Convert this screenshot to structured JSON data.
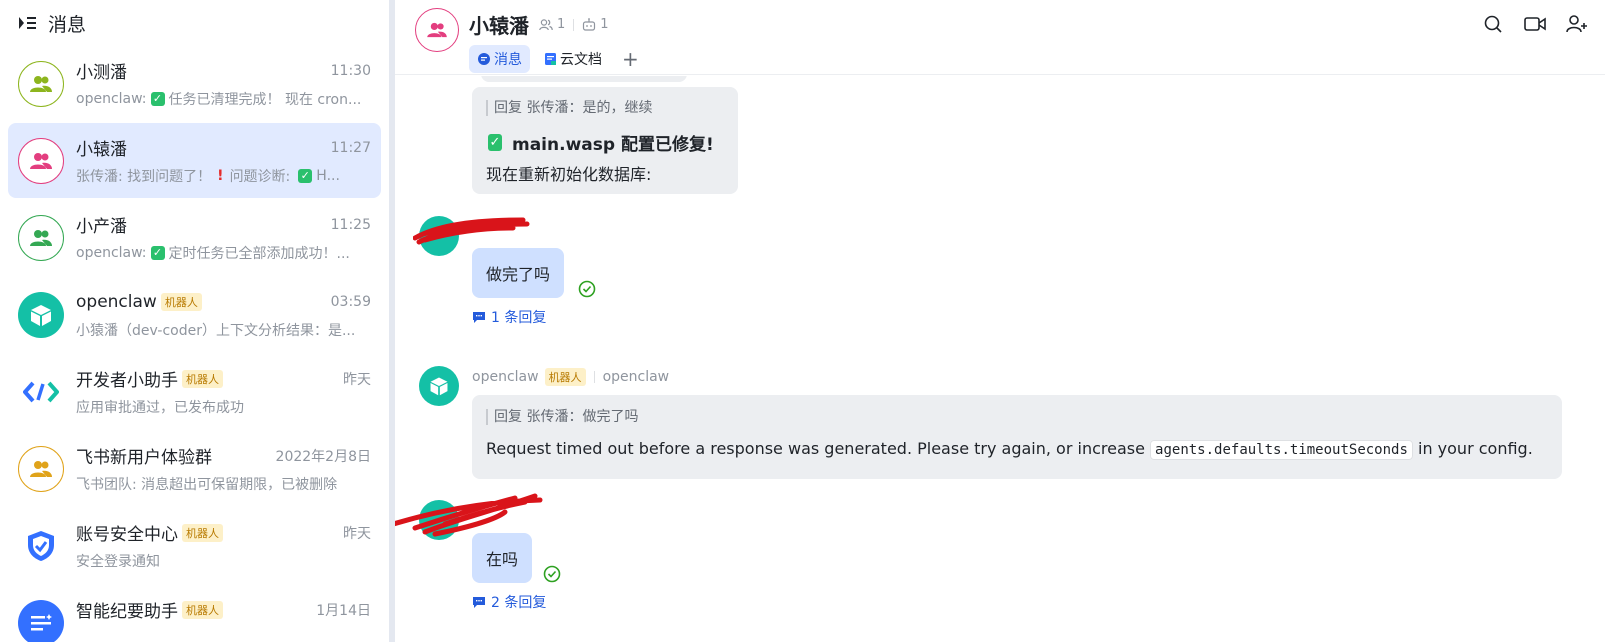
{
  "sidebar": {
    "title": "消息",
    "chats": [
      {
        "name": "小测潘",
        "time": "11:30",
        "preview_prefix": "openclaw:",
        "preview_text": "任务已清理完成！ 现在 cron...",
        "ring_color": "#8db51e"
      },
      {
        "name": "小辕潘",
        "time": "11:27",
        "preview_prefix": "张传潘: 找到问题了！",
        "preview_mid": "问题诊断:",
        "preview_text": "H...",
        "ring_color": "#e33e7f"
      },
      {
        "name": "小产潘",
        "time": "11:25",
        "preview_prefix": "openclaw:",
        "preview_text": "定时任务已全部添加成功！...",
        "ring_color": "#34a853"
      },
      {
        "name": "openclaw",
        "tag": "机器人",
        "time": "03:59",
        "preview_text": "小猿潘（dev-coder）上下文分析结果：是..."
      },
      {
        "name": "开发者小助手",
        "tag": "机器人",
        "time": "昨天",
        "preview_text": "应用审批通过，已发布成功"
      },
      {
        "name": "飞书新用户体验群",
        "time": "2022年2月8日",
        "preview_text": "飞书团队: 消息超出可保留期限，已被删除",
        "ring_color": "#e0a31a"
      },
      {
        "name": "账号安全中心",
        "tag": "机器人",
        "time": "昨天",
        "preview_text": "安全登录通知"
      },
      {
        "name": "智能纪要助手",
        "tag": "机器人",
        "time": "1月14日",
        "preview_text": ""
      }
    ]
  },
  "header": {
    "title": "小辕潘",
    "members": "1",
    "bots": "1",
    "tabs": [
      {
        "label": "消息"
      },
      {
        "label": "云文档"
      }
    ],
    "plus": "+"
  },
  "messages": {
    "m1": {
      "quote": "回复 张传潘：是的，继续",
      "title": "main.wasp 配置已修复!",
      "body": "现在重新初始化数据库:"
    },
    "m2": {
      "text": "做完了吗",
      "replies": "1 条回复"
    },
    "m3": {
      "sender": "openclaw",
      "tag": "机器人",
      "sender_alias": "openclaw",
      "quote": "回复 张传潘：做完了吗",
      "body_before": "Request timed out before a response was generated. Please try again, or increase",
      "code": "agents.defaults.timeoutSeconds",
      "body_after": "in your config."
    },
    "m4": {
      "text": "在吗",
      "replies": "2 条回复"
    }
  },
  "colors": {
    "accent": "#245bdb",
    "active_bg": "#e1eaff",
    "bot_teal": "#14c0a6",
    "read_green": "#2ea121",
    "scribble": "#d9141a"
  }
}
